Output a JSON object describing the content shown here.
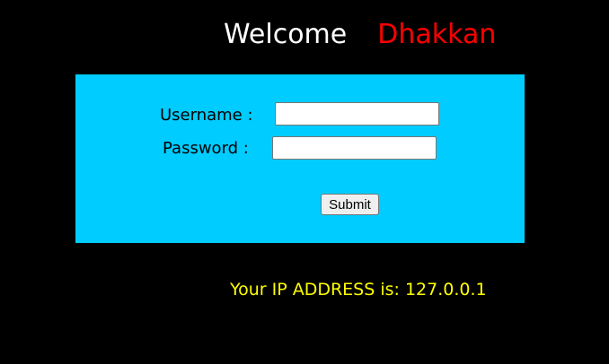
{
  "header": {
    "welcome": "Welcome",
    "username_display": "Dhakkan"
  },
  "form": {
    "username_label": "Username :",
    "username_value": "",
    "password_label": "Password :",
    "password_value": "",
    "submit_label": "Submit"
  },
  "footer": {
    "ip_text": "Your IP ADDRESS is: 127.0.0.1"
  },
  "colors": {
    "background": "#000000",
    "panel": "#00ccff",
    "welcome": "#ffffff",
    "username": "#ff0000",
    "ip_text": "#ffff00"
  }
}
